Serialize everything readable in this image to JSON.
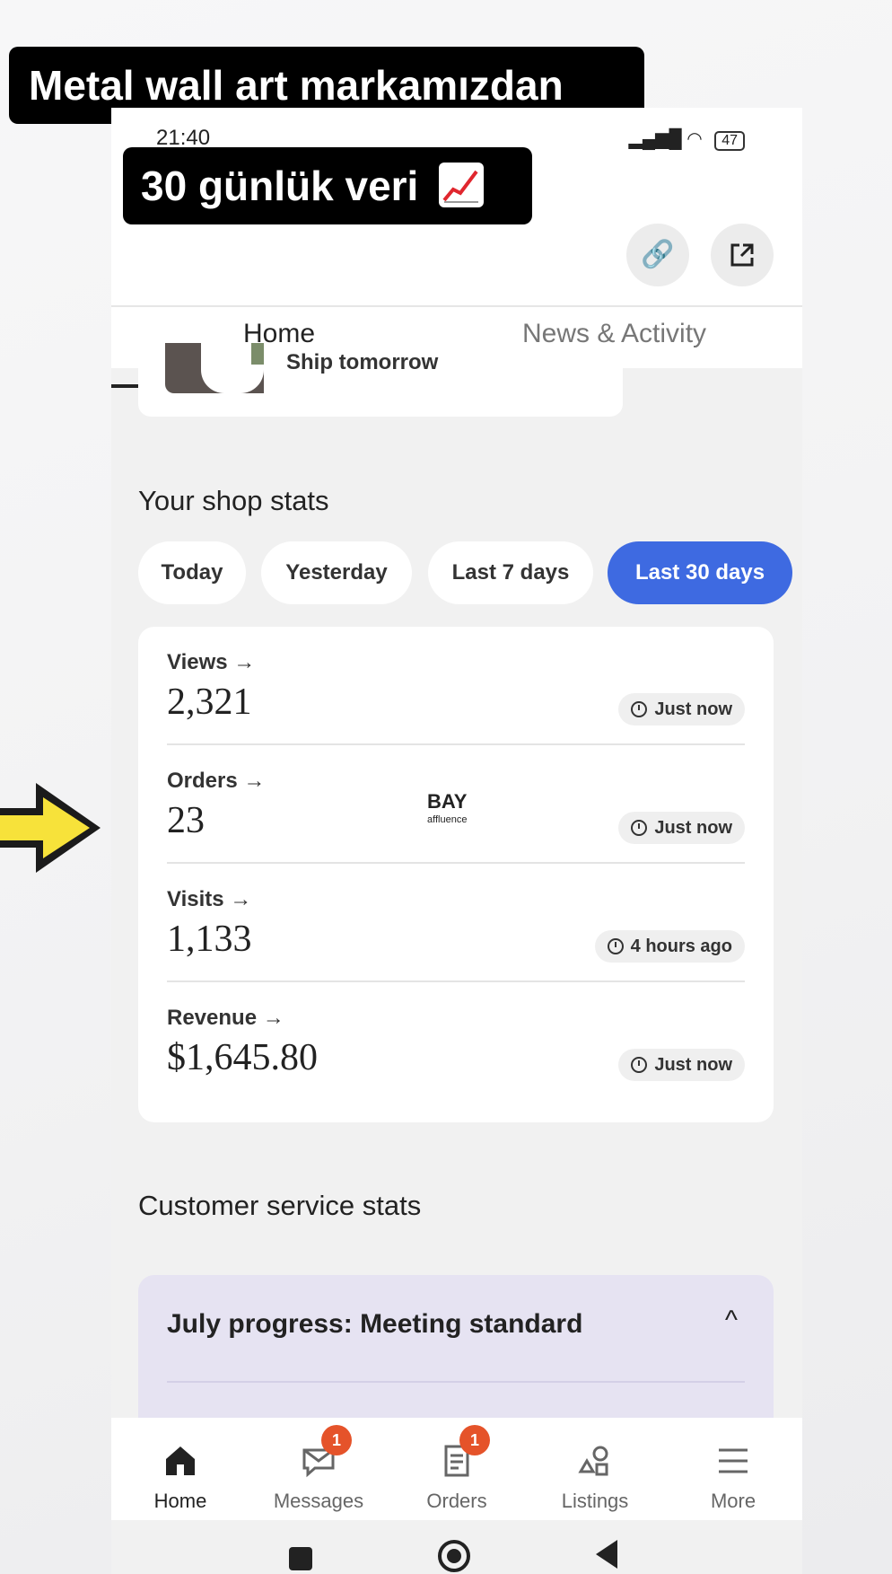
{
  "overlay": {
    "caption_line1": "Metal wall art markamızdan",
    "caption_line2": "30 günlük veri",
    "caption_icon": "chart-increasing-icon",
    "arrow_icon": "yellow-arrow-right-icon",
    "arrow_color": "#f7e23a"
  },
  "status_bar": {
    "time": "21:40",
    "battery": "47"
  },
  "header": {
    "link_icon": "link-icon",
    "share_icon": "share-icon",
    "tabs": [
      {
        "label": "Home",
        "active": true
      },
      {
        "label": "News & Activity",
        "active": false
      }
    ]
  },
  "order_preview": {
    "text": "Ship tomorrow"
  },
  "shop_stats": {
    "title": "Your shop stats",
    "periods": [
      {
        "label": "Today",
        "active": false
      },
      {
        "label": "Yesterday",
        "active": false
      },
      {
        "label": "Last 7 days",
        "active": false
      },
      {
        "label": "Last 30 days",
        "active": true
      }
    ],
    "stats": [
      {
        "label": "Views",
        "arrow": "→",
        "value": "2,321",
        "updated": "Just now"
      },
      {
        "label": "Orders",
        "arrow": "→",
        "value": "23",
        "updated": "Just now"
      },
      {
        "label": "Visits",
        "arrow": "→",
        "value": "1,133",
        "updated": "4 hours ago"
      },
      {
        "label": "Revenue",
        "arrow": "→",
        "value": "$1,645.80",
        "updated": "Just now"
      }
    ],
    "watermark": {
      "line1": "BAY",
      "line2": "affluence"
    }
  },
  "customer_service": {
    "title": "Customer service stats",
    "progress_text": "July progress: Meeting standard",
    "chevron": "^"
  },
  "bottom_nav": {
    "items": [
      {
        "label": "Home",
        "icon": "home-icon",
        "badge": "",
        "active": true
      },
      {
        "label": "Messages",
        "icon": "messages-icon",
        "badge": "1",
        "active": false
      },
      {
        "label": "Orders",
        "icon": "orders-icon",
        "badge": "1",
        "active": false
      },
      {
        "label": "Listings",
        "icon": "listings-icon",
        "badge": "",
        "active": false
      },
      {
        "label": "More",
        "icon": "menu-icon",
        "badge": "",
        "active": false
      }
    ]
  },
  "colors": {
    "accent": "#3e6ae1",
    "badge": "#e5532a",
    "progress_card": "#e6e3f2"
  }
}
